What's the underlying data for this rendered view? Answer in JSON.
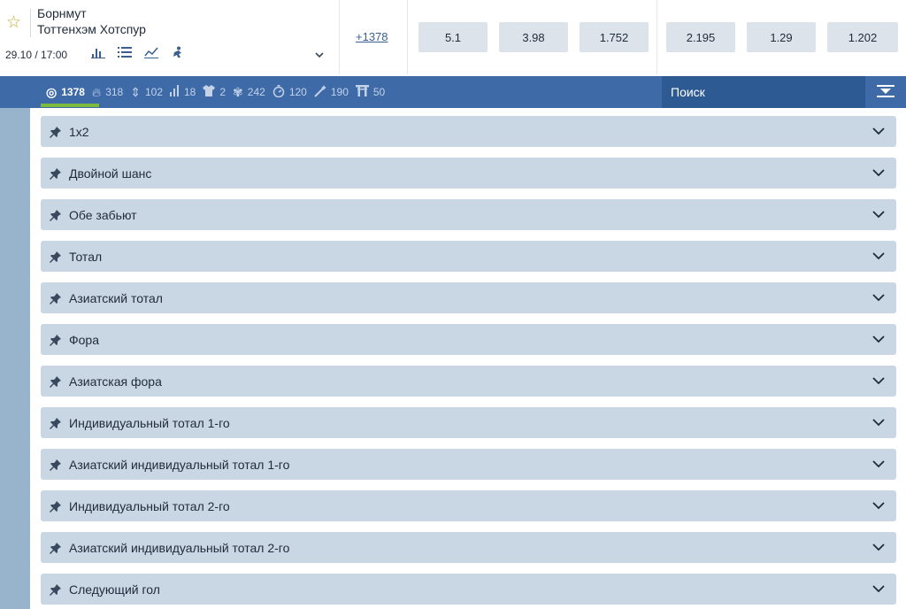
{
  "event": {
    "team1": "Борнмут",
    "team2": "Тоттенхэм Хотспур",
    "datetime": "29.10 / 17:00",
    "more_bets": "+1378",
    "icons": [
      "stats-icon",
      "list-icon",
      "chart-icon",
      "player-icon"
    ],
    "odds": [
      "5.1",
      "3.98",
      "1.752",
      "2.195",
      "1.29",
      "1.202"
    ]
  },
  "filters": [
    {
      "icon": "target-icon",
      "count": "1378",
      "active": true
    },
    {
      "icon": "fire-icon",
      "count": "318"
    },
    {
      "icon": "up-down-icon",
      "count": "102"
    },
    {
      "icon": "bars-icon",
      "count": "18"
    },
    {
      "icon": "shirt-icon",
      "count": "2"
    },
    {
      "icon": "star-badge-icon",
      "count": "242"
    },
    {
      "icon": "stopwatch-icon",
      "count": "120"
    },
    {
      "icon": "wand-icon",
      "count": "190"
    },
    {
      "icon": "gate-icon",
      "count": "50"
    }
  ],
  "search": {
    "placeholder": "Поиск"
  },
  "markets": [
    "1x2",
    "Двойной шанс",
    "Обе забьют",
    "Тотал",
    "Азиатский тотал",
    "Фора",
    "Азиатская фора",
    "Индивидуальный тотал 1-го",
    "Азиатский индивидуальный тотал 1-го",
    "Индивидуальный тотал 2-го",
    "Азиатский индивидуальный тотал 2-го",
    "Следующий гол"
  ],
  "colors": {
    "filter_bar": "#3e6aa8",
    "search_bg": "#2e5a93",
    "market_bg": "#c9d6e3",
    "odd_bg": "#dde3ea",
    "active_underline": "#7dbb3f"
  }
}
